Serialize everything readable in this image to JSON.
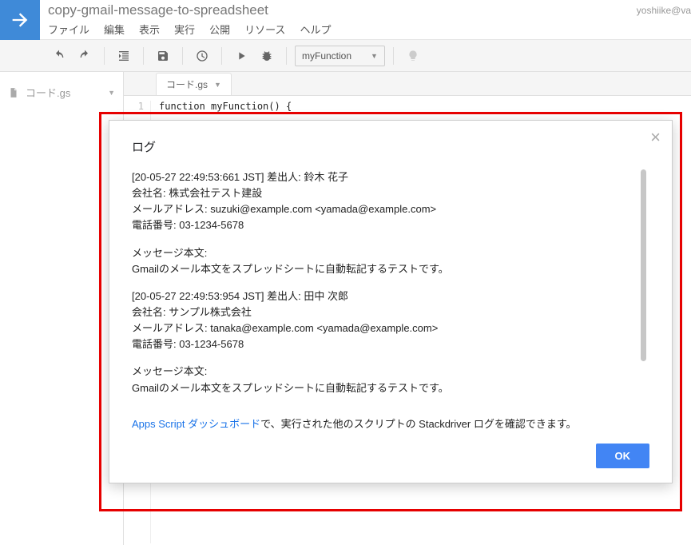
{
  "header": {
    "project_title": "copy-gmail-message-to-spreadsheet",
    "user_email": "yoshiike@va"
  },
  "menubar": {
    "file": "ファイル",
    "edit": "編集",
    "view": "表示",
    "run": "実行",
    "publish": "公開",
    "resources": "リソース",
    "help": "ヘルプ"
  },
  "toolbar": {
    "function_selected": "myFunction"
  },
  "sidebar": {
    "file_label": "コード.gs"
  },
  "tabs": {
    "active": "コード.gs"
  },
  "code": {
    "line1_num": "1",
    "line1_text": "function myFunction() {"
  },
  "dialog": {
    "title": "ログ",
    "entries": [
      {
        "l1": "[20-05-27 22:49:53:661 JST] 差出人: 鈴木 花子",
        "l2": "会社名: 株式会社テスト建設",
        "l3": "メールアドレス: suzuki@example.com <yamada@example.com>",
        "l4": "電話番号: 03-1234-5678"
      },
      {
        "l1": "メッセージ本文:",
        "l2": "Gmailのメール本文をスプレッドシートに自動転記するテストです。"
      },
      {
        "l1": "[20-05-27 22:49:53:954 JST] 差出人: 田中 次郎",
        "l2": "会社名: サンプル株式会社",
        "l3": "メールアドレス: tanaka@example.com <yamada@example.com>",
        "l4": "電話番号: 03-1234-5678"
      },
      {
        "l1": "メッセージ本文:",
        "l2": "Gmailのメール本文をスプレッドシートに自動転記するテストです。"
      }
    ],
    "footnote_link": "Apps Script ダッシュボード",
    "footnote_rest": "で、実行された他のスクリプトの Stackdriver ログを確認できます。",
    "ok": "OK"
  }
}
